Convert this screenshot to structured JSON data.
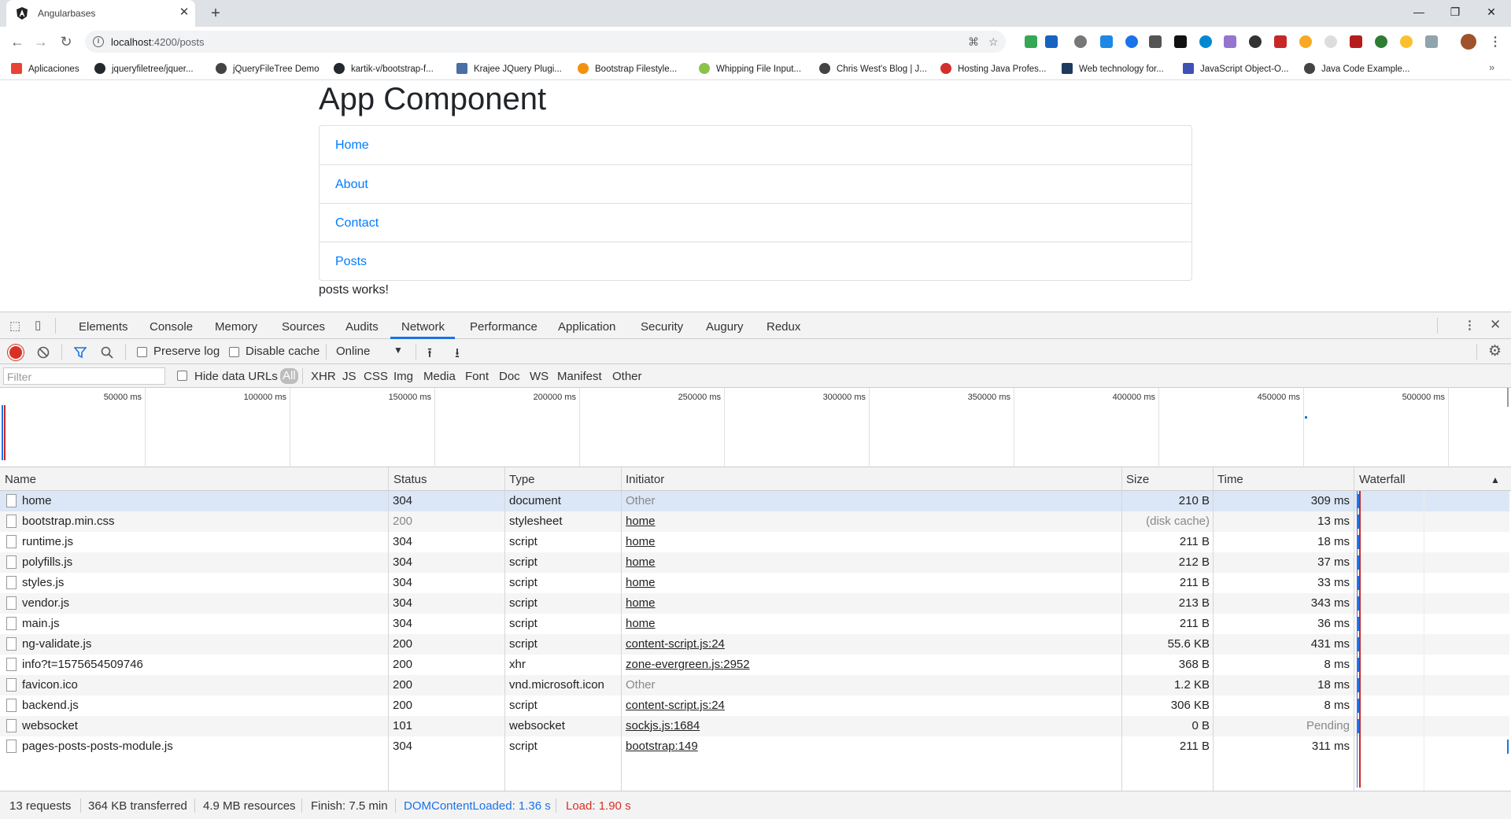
{
  "browser": {
    "tab_title": "Angularbases",
    "new_tab": "+",
    "close_tab": "✕",
    "minimize": "—",
    "maximize": "❐",
    "close_window": "✕",
    "url_host": "localhost",
    "url_rest": ":4200/posts"
  },
  "bookmarks": [
    {
      "label": "Aplicaciones",
      "color": "#ea4335"
    },
    {
      "label": "jqueryfiletree/jquer...",
      "color": "#24292e"
    },
    {
      "label": "jQueryFileTree Demo",
      "color": "#444444"
    },
    {
      "label": "kartik-v/bootstrap-f...",
      "color": "#24292e"
    },
    {
      "label": "Krajee JQuery Plugi...",
      "color": "#4a6fa5"
    },
    {
      "label": "Bootstrap Filestyle...",
      "color": "#f29111"
    },
    {
      "label": "Whipping File Input...",
      "color": "#8bc34a"
    },
    {
      "label": "Chris West's Blog | J...",
      "color": "#444444"
    },
    {
      "label": "Hosting Java Profes...",
      "color": "#d32f2f"
    },
    {
      "label": "Web technology for...",
      "color": "#1e3a5f"
    },
    {
      "label": "JavaScript Object-O...",
      "color": "#3f51b5"
    },
    {
      "label": "Java Code Example...",
      "color": "#444444"
    }
  ],
  "page": {
    "title": "App Component",
    "nav": [
      "Home",
      "About",
      "Contact",
      "Posts"
    ],
    "message": "posts works!"
  },
  "devtools": {
    "tabs": [
      "Elements",
      "Console",
      "Memory",
      "Sources",
      "Audits",
      "Network",
      "Performance",
      "Application",
      "Security",
      "Augury",
      "Redux"
    ],
    "active_tab": "Network",
    "toolbar": {
      "preserve_log": "Preserve log",
      "disable_cache": "Disable cache",
      "throttling": "Online"
    },
    "filter": {
      "placeholder": "Filter",
      "hide_data_urls": "Hide data URLs",
      "types": [
        "All",
        "XHR",
        "JS",
        "CSS",
        "Img",
        "Media",
        "Font",
        "Doc",
        "WS",
        "Manifest",
        "Other"
      ],
      "selected_type": "All"
    },
    "overview_ticks": [
      "50000 ms",
      "100000 ms",
      "150000 ms",
      "200000 ms",
      "250000 ms",
      "300000 ms",
      "350000 ms",
      "400000 ms",
      "450000 ms",
      "500000 ms"
    ],
    "columns": [
      "Name",
      "Status",
      "Type",
      "Initiator",
      "Size",
      "Time",
      "Waterfall"
    ],
    "sort_indicator": "▲",
    "rows": [
      {
        "name": "home",
        "status": "304",
        "type": "document",
        "initiator": "Other",
        "size": "210 B",
        "time": "309 ms"
      },
      {
        "name": "bootstrap.min.css",
        "status": "200",
        "type": "stylesheet",
        "initiator": "home",
        "size": "(disk cache)",
        "time": "13 ms"
      },
      {
        "name": "runtime.js",
        "status": "304",
        "type": "script",
        "initiator": "home",
        "size": "211 B",
        "time": "18 ms"
      },
      {
        "name": "polyfills.js",
        "status": "304",
        "type": "script",
        "initiator": "home",
        "size": "212 B",
        "time": "37 ms"
      },
      {
        "name": "styles.js",
        "status": "304",
        "type": "script",
        "initiator": "home",
        "size": "211 B",
        "time": "33 ms"
      },
      {
        "name": "vendor.js",
        "status": "304",
        "type": "script",
        "initiator": "home",
        "size": "213 B",
        "time": "343 ms"
      },
      {
        "name": "main.js",
        "status": "304",
        "type": "script",
        "initiator": "home",
        "size": "211 B",
        "time": "36 ms"
      },
      {
        "name": "ng-validate.js",
        "status": "200",
        "type": "script",
        "initiator": "content-script.js:24",
        "size": "55.6 KB",
        "time": "431 ms"
      },
      {
        "name": "info?t=1575654509746",
        "status": "200",
        "type": "xhr",
        "initiator": "zone-evergreen.js:2952",
        "size": "368 B",
        "time": "8 ms"
      },
      {
        "name": "favicon.ico",
        "status": "200",
        "type": "vnd.microsoft.icon",
        "initiator": "Other",
        "size": "1.2 KB",
        "time": "18 ms"
      },
      {
        "name": "backend.js",
        "status": "200",
        "type": "script",
        "initiator": "content-script.js:24",
        "size": "306 KB",
        "time": "8 ms"
      },
      {
        "name": "websocket",
        "status": "101",
        "type": "websocket",
        "initiator": "sockjs.js:1684",
        "size": "0 B",
        "time": "Pending"
      },
      {
        "name": "pages-posts-posts-module.js",
        "status": "304",
        "type": "script",
        "initiator": "bootstrap:149",
        "size": "211 B",
        "time": "311 ms"
      }
    ],
    "summary": {
      "requests": "13 requests",
      "transferred": "364 KB transferred",
      "resources": "4.9 MB resources",
      "finish": "Finish: 7.5 min",
      "dcl": "DOMContentLoaded: 1.36 s",
      "load": "Load: 1.90 s",
      "dcl_color": "#1a73e8",
      "load_color": "#d93025"
    }
  }
}
